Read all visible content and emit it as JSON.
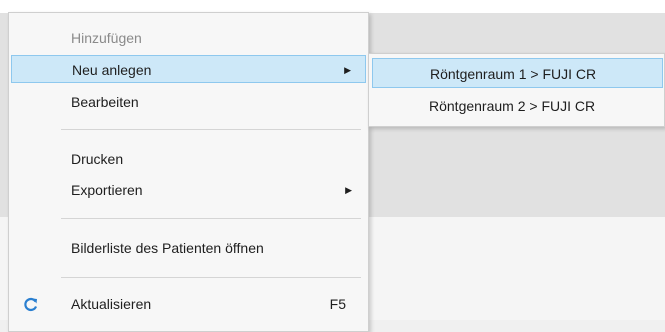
{
  "context_menu": {
    "items": [
      {
        "label": "Hinzufügen",
        "state": "disabled"
      },
      {
        "label": "Neu anlegen",
        "state": "highlighted",
        "has_submenu": true
      },
      {
        "label": "Bearbeiten"
      },
      {
        "label": "Drucken"
      },
      {
        "label": "Exportieren",
        "has_submenu": true
      },
      {
        "label": "Bilderliste des Patienten öffnen"
      },
      {
        "label": "Aktualisieren",
        "shortcut": "F5",
        "icon": "refresh-icon"
      }
    ]
  },
  "submenu": {
    "items": [
      {
        "label": "Röntgenraum 1 > FUJI CR",
        "state": "highlighted"
      },
      {
        "label": "Röntgenraum 2 > FUJI CR"
      }
    ]
  },
  "colors": {
    "highlight": "#cde8f8",
    "highlight_border": "#8ec8ee",
    "disabled_text": "#8a8a8a",
    "refresh_icon": "#2a7fd0"
  }
}
